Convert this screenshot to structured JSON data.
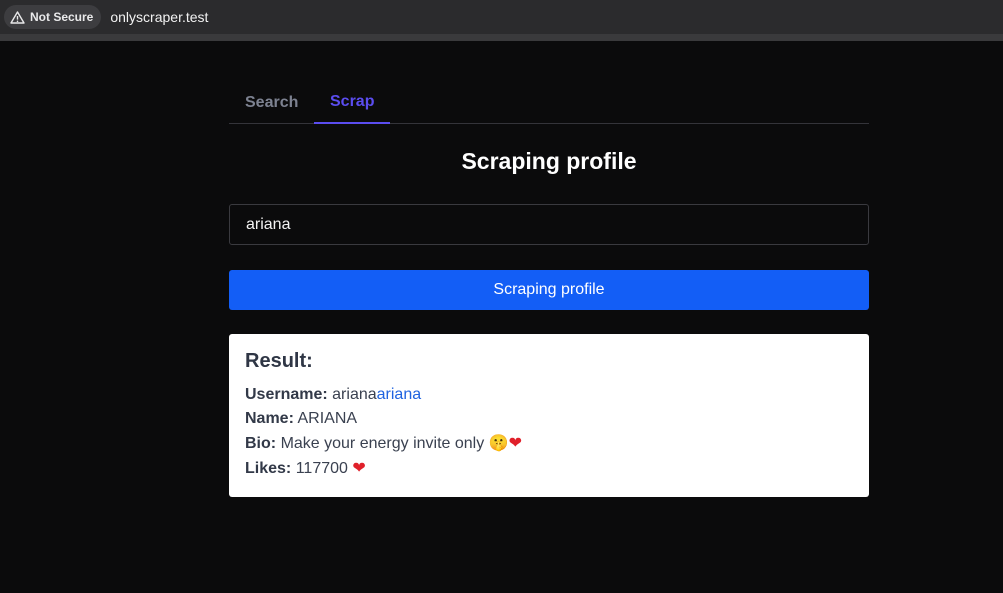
{
  "browser": {
    "security_label": "Not Secure",
    "url": "onlyscraper.test"
  },
  "tabs": [
    {
      "label": "Search",
      "active": false
    },
    {
      "label": "Scrap",
      "active": true
    }
  ],
  "page_title": "Scraping profile",
  "form": {
    "query_value": "ariana",
    "submit_label": "Scraping profile"
  },
  "result": {
    "heading": "Result:",
    "username_label": "Username:",
    "username_value": "ariana",
    "username_link": "ariana",
    "name_label": "Name:",
    "name_value": "ARIANA",
    "bio_label": "Bio:",
    "bio_text": "Make your energy invite only",
    "bio_emoji_1": "🤫",
    "bio_emoji_2": "❤",
    "likes_label": "Likes:",
    "likes_value": "117700",
    "likes_emoji": "❤"
  },
  "colors": {
    "accent": "#5b4df0",
    "button": "#135ef6",
    "link": "#1f63e0",
    "background": "#0b0b0c"
  },
  "icons": [
    "warning-icon",
    "shush-face-icon",
    "heart-icon"
  ]
}
